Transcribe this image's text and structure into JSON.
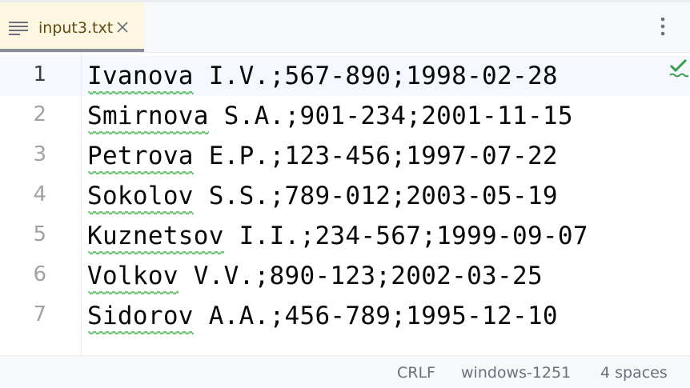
{
  "tab": {
    "filename": "input3.txt",
    "icon": "text-file-icon",
    "close_icon": "close-icon"
  },
  "toolbar": {
    "more_icon": "more-vertical-icon"
  },
  "inspection": {
    "icon": "check-icon",
    "color": "#3b9d4c"
  },
  "editor": {
    "current_line": 1,
    "lines": [
      {
        "number": "1",
        "text": "Ivanova I.V.;567-890;1998-02-28"
      },
      {
        "number": "2",
        "text": "Smirnova S.A.;901-234;2001-11-15"
      },
      {
        "number": "3",
        "text": "Petrova E.P.;123-456;1997-07-22"
      },
      {
        "number": "4",
        "text": "Sokolov S.S.;789-012;2003-05-19"
      },
      {
        "number": "5",
        "text": "Kuznetsov I.I.;234-567;1999-09-07"
      },
      {
        "number": "6",
        "text": "Volkov V.V.;890-123;2002-03-25"
      },
      {
        "number": "7",
        "text": "Sidorov A.A.;456-789;1995-12-10"
      }
    ]
  },
  "status": {
    "line_separator": "CRLF",
    "encoding": "windows-1251",
    "indent": "4 spaces"
  },
  "colors": {
    "tab_active_bg": "#fdf6e1",
    "squiggle": "#5fb865",
    "current_line_bg": "#f5f8fe"
  }
}
